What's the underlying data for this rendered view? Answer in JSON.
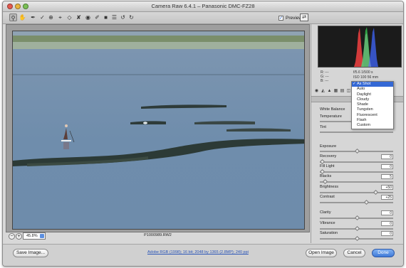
{
  "window": {
    "title": "Camera Raw 6.4.1  –  Panasonic DMC-FZ28"
  },
  "toolbar": {
    "tools": [
      "zoom-tool-icon",
      "hand-tool-icon",
      "white-balance-tool-icon",
      "color-sampler-tool-icon",
      "targeted-adjustment-tool-icon",
      "crop-tool-icon",
      "straighten-tool-icon",
      "spot-removal-tool-icon",
      "red-eye-removal-tool-icon",
      "adjustment-brush-icon",
      "graduated-filter-icon",
      "preferences-icon",
      "rotate-left-icon",
      "rotate-right-icon"
    ],
    "preview_label": "Preview",
    "preview_checked": true
  },
  "image": {
    "zoom_value": "45.8%",
    "filename": "P1000989.RW2"
  },
  "readout": {
    "r": "R:   ---",
    "g": "G:   ---",
    "b": "B:   ---",
    "aperture_shutter": "f/5.6    1/500 s",
    "iso_focal": "ISO 100    56 mm"
  },
  "panel": {
    "section_title": "Basic",
    "white_balance_label": "White Balance",
    "white_balance_options": [
      "As Shot",
      "Auto",
      "Daylight",
      "Cloudy",
      "Shade",
      "Tungsten",
      "Fluorescent",
      "Flash",
      "Custom"
    ],
    "white_balance_selected": "As Shot",
    "temperature_label": "Temperature",
    "tint_label": "Tint",
    "exposure_label": "Exposure",
    "recovery_label": "Recovery",
    "recovery_value": "0",
    "fill_light_label": "Fill Light",
    "fill_light_value": "0",
    "blacks_label": "Blacks",
    "blacks_value": "5",
    "brightness_label": "Brightness",
    "brightness_value": "+50",
    "contrast_label": "Contrast",
    "contrast_value": "+25",
    "clarity_label": "Clarity",
    "clarity_value": "0",
    "vibrance_label": "Vibrance",
    "vibrance_value": "0",
    "saturation_label": "Saturation",
    "saturation_value": "0"
  },
  "bottom": {
    "save_label": "Save Image...",
    "workflow_text": "Adobe RGB (1998); 16 bit; 2048 by 1365 (2.8MP); 240 ppi",
    "open_label": "Open Image",
    "cancel_label": "Cancel",
    "done_label": "Done"
  },
  "colors": {
    "accent": "#3468d5",
    "histogram_bg": "#1b1b1b",
    "water": "#6f8fb1",
    "sky": "#9fb4c6"
  }
}
